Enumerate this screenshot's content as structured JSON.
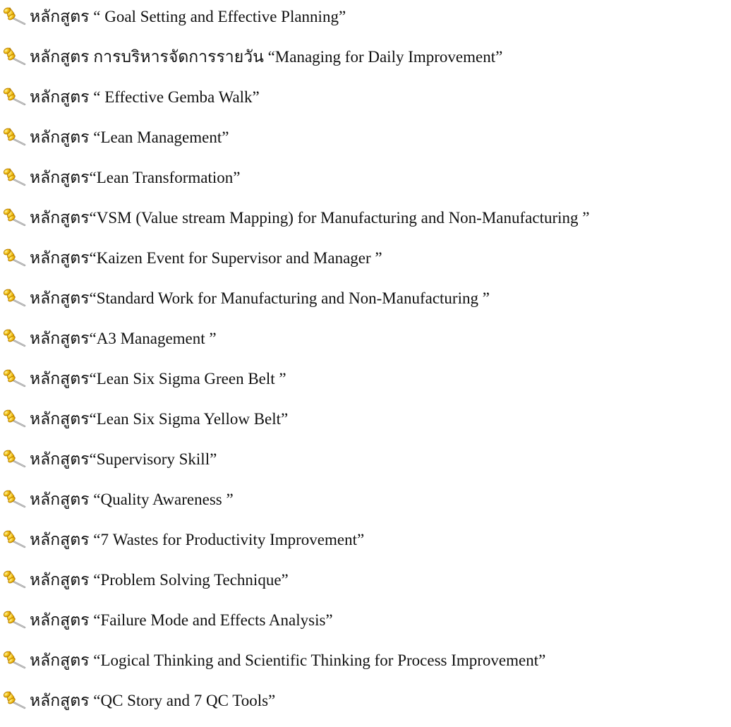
{
  "icon": "pushpin-icon",
  "courses": [
    "หลักสูตร “ Goal Setting and Effective Planning”",
    "หลักสูตร การบริหารจัดการรายวัน “Managing for Daily Improvement”",
    "หลักสูตร “ Effective Gemba Walk”",
    "หลักสูตร “Lean Management”",
    "หลักสูตร“Lean Transformation”",
    "หลักสูตร“VSM (Value stream Mapping) for Manufacturing and Non-Manufacturing ”",
    "หลักสูตร“Kaizen Event for Supervisor and Manager ”",
    "หลักสูตร“Standard Work for Manufacturing and Non-Manufacturing ”",
    "หลักสูตร“A3 Management ”",
    "หลักสูตร“Lean Six Sigma Green Belt ”",
    "หลักสูตร“Lean Six Sigma  Yellow Belt”",
    "หลักสูตร“Supervisory Skill”",
    "หลักสูตร “Quality Awareness ”",
    "หลักสูตร “7 Wastes for Productivity Improvement”",
    "หลักสูตร “Problem Solving Technique”",
    "หลักสูตร “Failure Mode and Effects Analysis”",
    "หลักสูตร “Logical Thinking and Scientific Thinking for Process Improvement”",
    "หลักสูตร “QC Story and 7 QC Tools”"
  ]
}
